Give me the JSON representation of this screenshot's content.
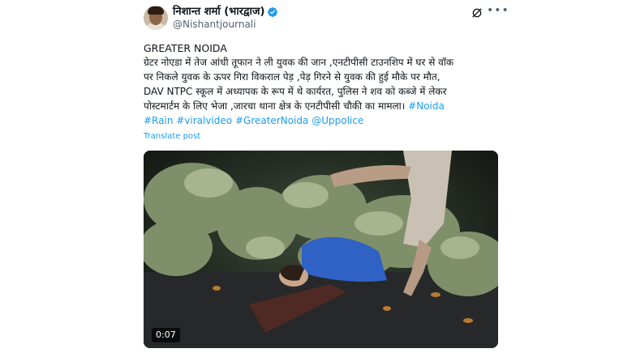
{
  "post": {
    "author_name": "निशान्त शर्मा (भारद्वाज)",
    "author_handle": "@Nishantjournali",
    "heading": "GREATER NOIDA",
    "body_lines": [
      "ग्रेटर नोएडा में तेज आंधी तूफान ने ली युवक की जान ,एनटीपीसी टाउनशिप में घर से वॉक",
      "पर निकले युवक के ऊपर गिरा विकराल पेड़ ,पेड़ गिरने से युवक की हुई मौके पर मौत,",
      "DAV NTPC स्कूल में अध्यापक के रूप में थे कार्यरत, पुलिस ने शव को कब्जे में लेकर",
      "पोस्टमार्टम के लिए भेजा ,जारचा थाना क्षेत्र के एनटीपीसी चौकी का मामला।"
    ],
    "hashtags": [
      "#Noida",
      "#Rain",
      "#viralvideo",
      "#GreaterNoida",
      "@Uppolice"
    ],
    "translate_label": "Translate post",
    "video_duration": "0:07"
  },
  "icons": {
    "verified": "verified-badge-icon",
    "grok": "grok-icon",
    "more": "more-options-icon"
  },
  "colors": {
    "accent": "#1d9bf0",
    "text": "#0f1419",
    "secondary": "#536471"
  }
}
